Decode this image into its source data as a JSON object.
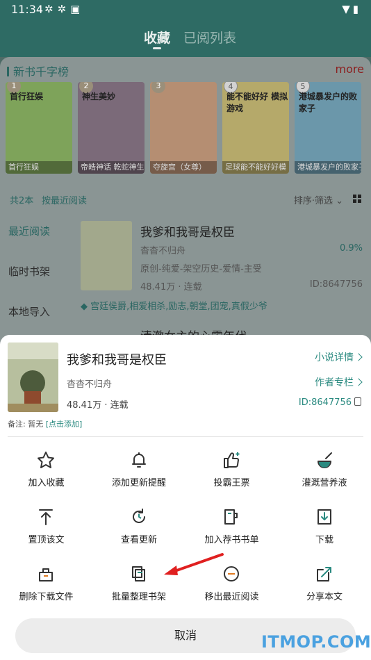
{
  "status_bar": {
    "time": "11:34"
  },
  "top_tabs": {
    "favorites": "收藏",
    "read_list": "已阅列表"
  },
  "ranking": {
    "title": "新书千字榜",
    "more": "more",
    "books": [
      {
        "label": "首行狂娱",
        "badge": "1",
        "cover_color": "#7ea35a",
        "cover_title": "首行狂娱"
      },
      {
        "label": "帝皓神话 乾蛇神生",
        "badge": "2",
        "cover_color": "#7b6a79",
        "cover_title": "神生美妙"
      },
      {
        "label": "夺旋宫（女尊）",
        "badge": "3",
        "cover_color": "#b58e72",
        "cover_title": ""
      },
      {
        "label": "足球能不能好好模",
        "badge": "4",
        "cover_color": "#b5a96a",
        "cover_title": "能不能好好 模拟游戏"
      },
      {
        "label": "港城暴发户的败家子",
        "badge": "5",
        "cover_color": "#6b97aa",
        "cover_title": "港城暴发户的败家子"
      }
    ]
  },
  "shelf": {
    "count": "共2本",
    "sort": "按最近阅读",
    "filter": "排序·筛选",
    "left_nav": [
      "最近阅读",
      "临时书架",
      "本地导入"
    ],
    "book": {
      "title": "我爹和我哥是权臣",
      "author": "杳杳不归舟",
      "progress": "0.9%",
      "tags": "原创-纯爱-架空历史-爱情-主受",
      "word_count": "48.41万 · 连载",
      "id": "ID:8647756",
      "keywords": "宫廷侯爵,相爱相杀,励志,朝堂,团宠,真假少爷"
    },
    "next_title": "清澈女主的心需年代"
  },
  "sheet": {
    "title": "我爹和我哥是权臣",
    "author": "杳杳不归舟",
    "word_count": "48.41万 · 连载",
    "detail_link": "小说详情",
    "author_column": "作者专栏",
    "id": "ID:8647756",
    "note_label": "备注: 暂无 ",
    "note_link": "[点击添加]",
    "actions": [
      {
        "label": "加入收藏",
        "icon": "star-icon"
      },
      {
        "label": "添加更新提醒",
        "icon": "bell-icon"
      },
      {
        "label": "投霸王票",
        "icon": "thumbs-up-icon"
      },
      {
        "label": "灌溉营养液",
        "icon": "flask-icon"
      },
      {
        "label": "置顶该文",
        "icon": "pin-top-icon"
      },
      {
        "label": "查看更新",
        "icon": "refresh-icon"
      },
      {
        "label": "加入荐书书单",
        "icon": "booklist-icon"
      },
      {
        "label": "下载",
        "icon": "download-icon"
      },
      {
        "label": "删除下载文件",
        "icon": "delete-download-icon"
      },
      {
        "label": "批量整理书架",
        "icon": "batch-organize-icon"
      },
      {
        "label": "移出最近阅读",
        "icon": "remove-icon"
      },
      {
        "label": "分享本文",
        "icon": "share-icon"
      }
    ],
    "cancel": "取消"
  },
  "colors": {
    "accent": "#2a8a80",
    "header": "#2e6b64",
    "highlight_arrow": "#e02020"
  },
  "watermark": "ITMOP.COM"
}
